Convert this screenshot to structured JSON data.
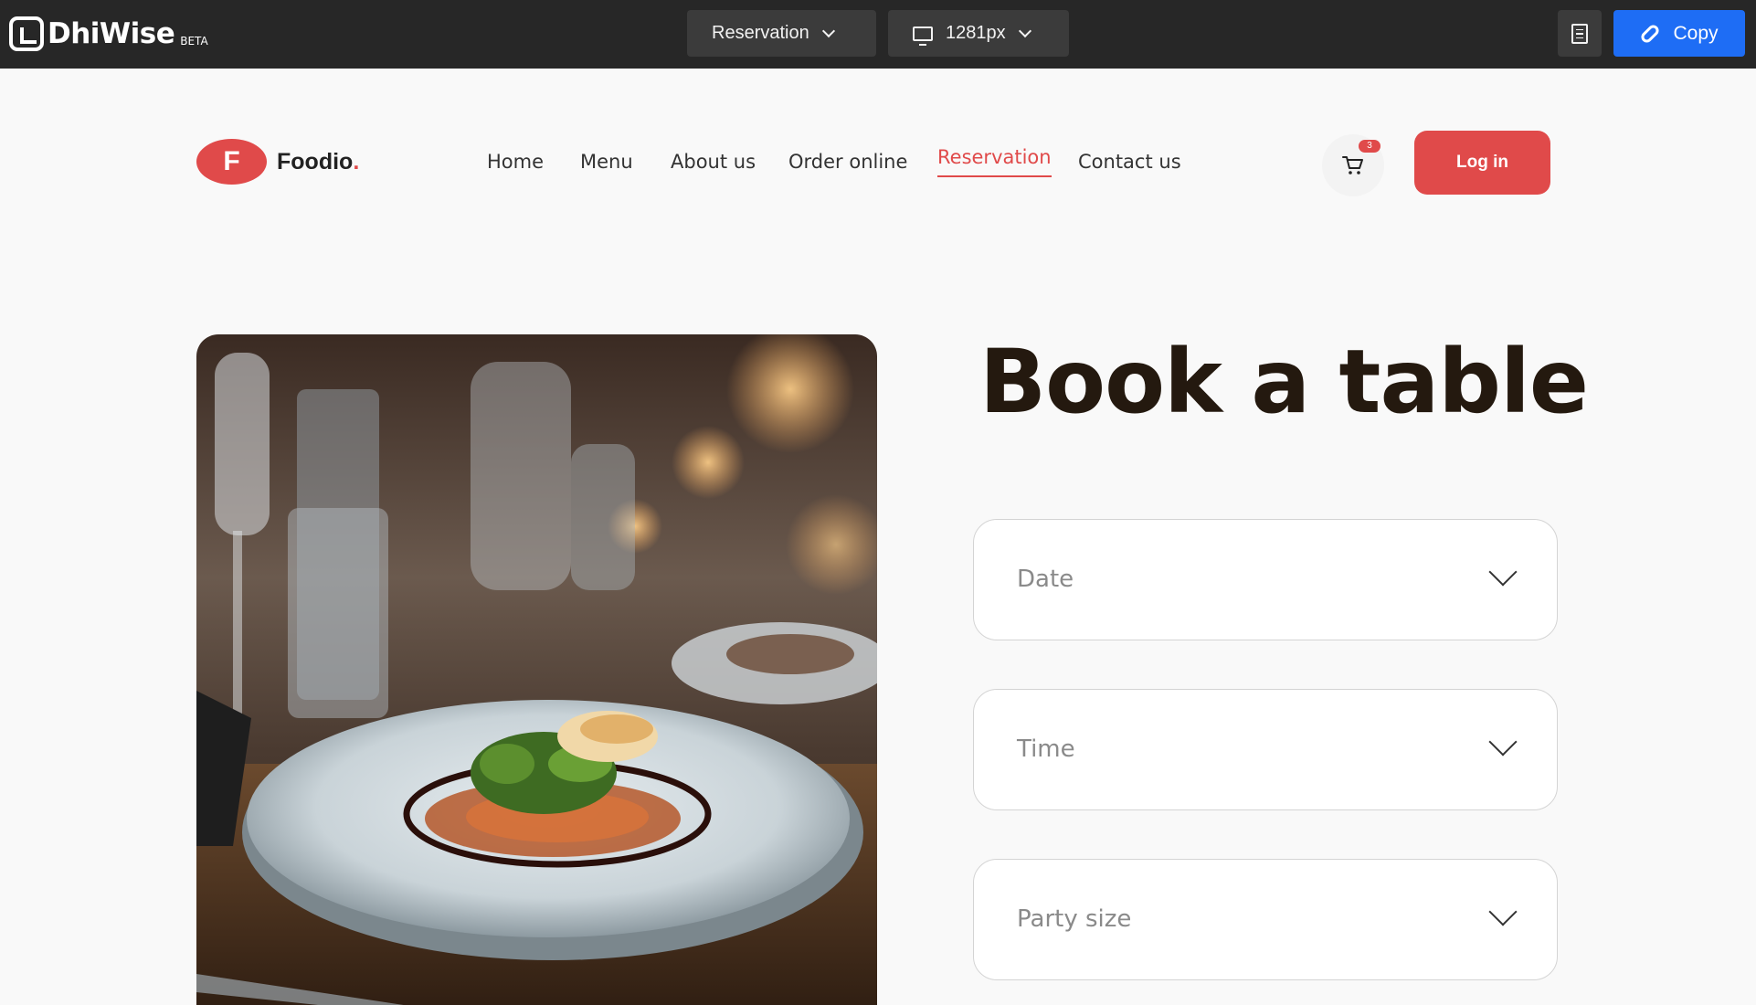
{
  "editor": {
    "brand": "DhiWise",
    "brand_tag": "BETA",
    "screen_select": "Reservation",
    "device_select": "1281px",
    "copy_label": "Copy"
  },
  "site": {
    "logo_letter": "F",
    "logo_name": "Foodio",
    "logo_dot": ".",
    "nav": [
      {
        "label": "Home"
      },
      {
        "label": "Menu"
      },
      {
        "label": "About us"
      },
      {
        "label": "Order online"
      },
      {
        "label": "Reservation",
        "active": true
      },
      {
        "label": "Contact us"
      }
    ],
    "cart_count": "3",
    "login_label": "Log in",
    "accent_color": "#e04a4a"
  },
  "reservation": {
    "heading": "Book a table",
    "fields": [
      {
        "label": "Date"
      },
      {
        "label": "Time"
      },
      {
        "label": "Party size"
      }
    ]
  }
}
